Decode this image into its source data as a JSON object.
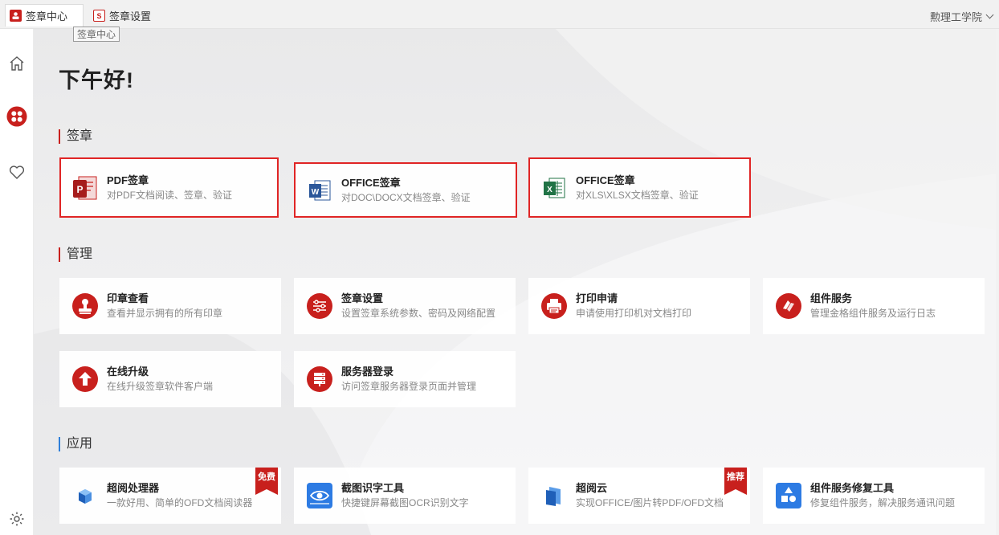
{
  "tabs": [
    {
      "label": "签章中心",
      "icon": "seal-user-icon"
    },
    {
      "label": "签章设置",
      "icon": "seal-settings-icon"
    }
  ],
  "tooltip": "签章中心",
  "user": {
    "name": "勲理工学院"
  },
  "sidebar": {
    "icons": [
      "home-icon",
      "apps-icon",
      "favorites-icon",
      "settings-icon"
    ]
  },
  "greeting": "下午好!",
  "sections": {
    "sign": {
      "title": "签章",
      "cards": [
        {
          "title": "PDF签章",
          "desc": "对PDF文档阅读、签章、验证",
          "icon": "pdf-icon"
        },
        {
          "title": "OFFICE签章",
          "desc": "对DOC\\DOCX文档签章、验证",
          "icon": "word-icon"
        },
        {
          "title": "OFFICE签章",
          "desc": "对XLS\\XLSX文档签章、验证",
          "icon": "excel-icon"
        }
      ]
    },
    "manage": {
      "title": "管理",
      "cards": [
        {
          "title": "印章查看",
          "desc": "查看并显示拥有的所有印章",
          "icon": "stamp-icon"
        },
        {
          "title": "签章设置",
          "desc": "设置签章系统参数、密码及网络配置",
          "icon": "sliders-icon"
        },
        {
          "title": "打印申请",
          "desc": "申请使用打印机对文档打印",
          "icon": "printer-icon"
        },
        {
          "title": "组件服务",
          "desc": "管理金格组件服务及运行日志",
          "icon": "service-icon"
        },
        {
          "title": "在线升级",
          "desc": "在线升级签章软件客户端",
          "icon": "upgrade-icon"
        },
        {
          "title": "服务器登录",
          "desc": "访问签章服务器登录页面并管理",
          "icon": "server-icon"
        }
      ]
    },
    "apps": {
      "title": "应用",
      "cards": [
        {
          "title": "超阅处理器",
          "desc": "一款好用、简单的OFD文档阅读器",
          "icon": "ofd-reader-icon",
          "badge": "免费"
        },
        {
          "title": "截图识字工具",
          "desc": "快捷键屏幕截图OCR识别文字",
          "icon": "ocr-eye-icon"
        },
        {
          "title": "超阅云",
          "desc": "实现OFFICE/图片转PDF/OFD文档",
          "icon": "cloud-doc-icon",
          "badge": "推荐"
        },
        {
          "title": "组件服务修复工具",
          "desc": "修复组件服务，解决服务通讯问题",
          "icon": "repair-shapes-icon"
        }
      ]
    }
  },
  "colors": {
    "accent": "#c8201d",
    "highlight": "#e02525",
    "blue": "#2f7fd9"
  }
}
